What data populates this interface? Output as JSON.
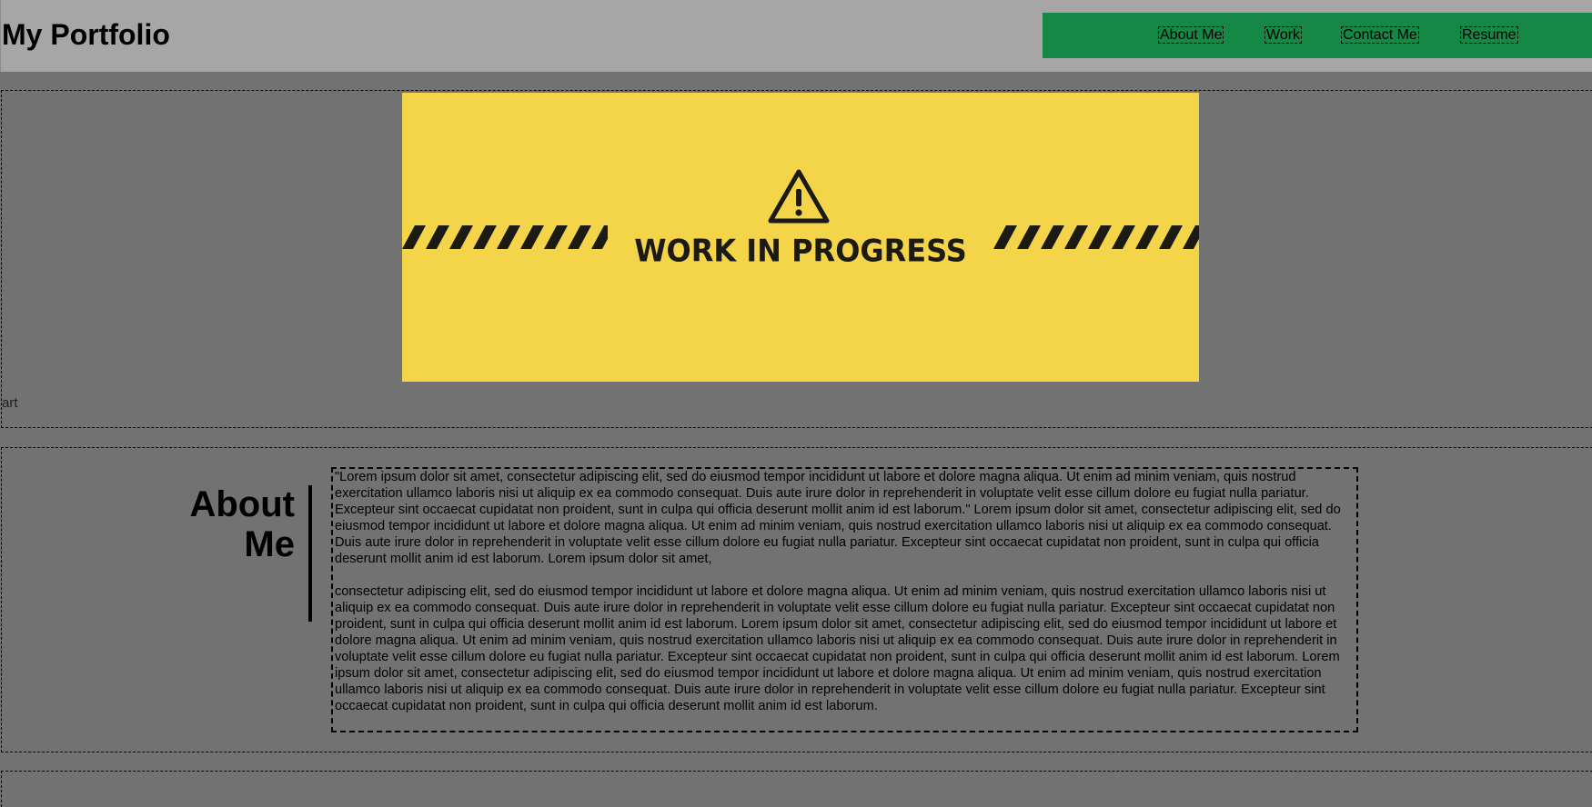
{
  "header": {
    "title": "My Portfolio",
    "nav": [
      {
        "label": "About Me"
      },
      {
        "label": "Work"
      },
      {
        "label": "Contact Me"
      },
      {
        "label": "Resume"
      }
    ],
    "nav_color": "#168845"
  },
  "hero": {
    "banner_text": "WORK IN PROGRESS",
    "banner_color": "#f4d54a",
    "banner_icon": "warning-icon",
    "caption": "art"
  },
  "about": {
    "heading": "About Me",
    "paragraphs": [
      "\"Lorem ipsum dolor sit amet, consectetur adipiscing elit, sed do eiusmod tempor incididunt ut labore et dolore magna aliqua. Ut enim ad minim veniam, quis nostrud exercitation ullamco laboris nisi ut aliquip ex ea commodo consequat. Duis aute irure dolor in reprehenderit in voluptate velit esse cillum dolore eu fugiat nulla pariatur. Excepteur sint occaecat cupidatat non proident, sunt in culpa qui officia deserunt mollit anim id est laborum.\" Lorem ipsum dolor sit amet, consectetur adipiscing elit, sed do eiusmod tempor incididunt ut labore et dolore magna aliqua. Ut enim ad minim veniam, quis nostrud exercitation ullamco laboris nisi ut aliquip ex ea commodo consequat. Duis aute irure dolor in reprehenderit in voluptate velit esse cillum dolore eu fugiat nulla pariatur. Excepteur sint occaecat cupidatat non proident, sunt in culpa qui officia deserunt mollit anim id est laborum. Lorem ipsum dolor sit amet,",
      "consectetur adipiscing elit, sed do eiusmod tempor incididunt ut labore et dolore magna aliqua. Ut enim ad minim veniam, quis nostrud exercitation ullamco laboris nisi ut aliquip ex ea commodo consequat. Duis aute irure dolor in reprehenderit in voluptate velit esse cillum dolore eu fugiat nulla pariatur. Excepteur sint occaecat cupidatat non proident, sunt in culpa qui officia deserunt mollit anim id est laborum. Lorem ipsum dolor sit amet, consectetur adipiscing elit, sed do eiusmod tempor incididunt ut labore et dolore magna aliqua. Ut enim ad minim veniam, quis nostrud exercitation ullamco laboris nisi ut aliquip ex ea commodo consequat. Duis aute irure dolor in reprehenderit in voluptate velit esse cillum dolore eu fugiat nulla pariatur. Excepteur sint occaecat cupidatat non proident, sunt in culpa qui officia deserunt mollit anim id est laborum. Lorem ipsum dolor sit amet, consectetur adipiscing elit, sed do eiusmod tempor incididunt ut labore et dolore magna aliqua. Ut enim ad minim veniam, quis nostrud exercitation ullamco laboris nisi ut aliquip ex ea commodo consequat. Duis aute irure dolor in reprehenderit in voluptate velit esse cillum dolore eu fugiat nulla pariatur. Excepteur sint occaecat cupidatat non proident, sunt in culpa qui officia deserunt mollit anim id est laborum."
    ]
  }
}
